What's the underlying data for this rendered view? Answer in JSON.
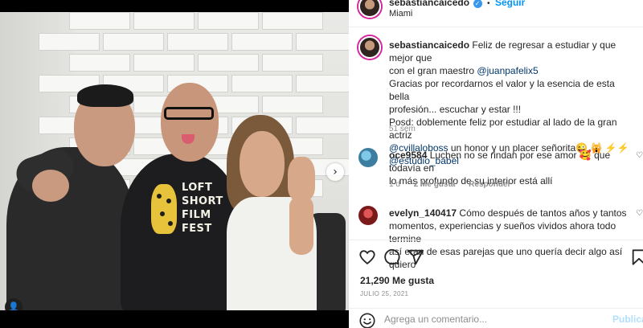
{
  "post": {
    "username": "sebastiancaicedo",
    "follow_label": "Seguir",
    "separator": "•",
    "location": "Miami",
    "verified_mark": "✓"
  },
  "photo": {
    "logo_lines": [
      "LOFT",
      "SHORT",
      "FILM",
      "FEST"
    ],
    "next_icon": "chevron-right-icon",
    "next_glyph": "›",
    "tag_icon": "user-tag-icon",
    "tag_glyph": "👤"
  },
  "caption": {
    "username": "sebastiancaicedo",
    "line1": "Feliz de regresar a estudiar y que mejor que",
    "line2_prefix": "con el gran maestro ",
    "line2_mention": "@juanpafelix5",
    "line3": "Gracias por recordarnos el valor y la esencia de esta bella",
    "line4": "profesión... escuchar y estar !!!",
    "line5": "Posd: doblemente feliz por estudiar al lado de la gran actriz",
    "line6_mention": "@cvillaloboss",
    "line6_rest": " un honor y un placer señorita😜 🙀 ⚡⚡",
    "line7_mention": "@estudio_babel",
    "time": "51 sem"
  },
  "comments": [
    {
      "username": "oce9584",
      "line1": " Luchen no se rindan por ese amor 🥰 que todavía en",
      "line2": "lo más profundo de su interior está allí",
      "meta_time": "1 d",
      "meta_likes": "2 Me gusta",
      "meta_reply": "Responder"
    },
    {
      "username": "evelyn_140417",
      "line1": " Cómo después de tantos años y tantos",
      "line2": "momentos, experiencias y sueños vividos ahora todo termine",
      "line3": "así eran de esas parejas que uno quería decir algo así quiero"
    }
  ],
  "actions": {
    "likes": "21,290 Me gusta",
    "date": "JULIO 25, 2021",
    "comment_placeholder": "Agrega un comentario...",
    "publish_label": "Publicar"
  },
  "icons": [
    "heart-icon",
    "comment-icon",
    "share-icon",
    "bookmark-icon",
    "emoji-icon",
    "verified-icon"
  ],
  "colors": {
    "accent": "#0095f6",
    "mention": "#00376b",
    "muted": "#8e8e8e",
    "publish_disabled": "#b2dffc"
  }
}
